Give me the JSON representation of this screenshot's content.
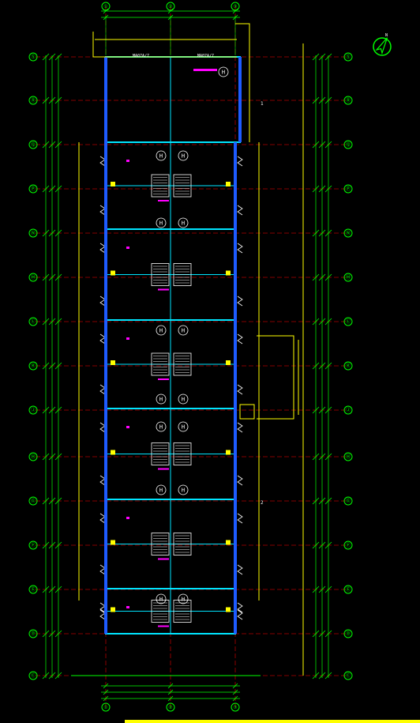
{
  "colors": {
    "background": "#000000",
    "grid_line": "#b00000",
    "dimension": "#00ff00",
    "wall": "#00e5ff",
    "wall_fill": "#1e5bff",
    "annotation": "#ff00ff",
    "stair": "#ffffff",
    "misc": "#ffff00"
  },
  "grid_axes": {
    "columns": [
      "①",
      "②",
      "③"
    ],
    "rows": [
      "Ⓢ",
      "Ⓡ",
      "Ⓠ",
      "Ⓟ",
      "Ⓝ",
      "Ⓜ",
      "Ⓛ",
      "Ⓚ",
      "Ⓙ",
      "Ⓗ",
      "Ⓖ",
      "Ⓕ",
      "Ⓔ",
      "Ⓓ",
      "Ⓒ",
      "Ⓑ"
    ]
  },
  "north_arrow": {
    "label": "N",
    "icon": "north-arrow-icon"
  },
  "room_tags": {
    "top_room": "H",
    "unit": [
      "H",
      "H",
      "H",
      "H",
      "H",
      "H",
      "H",
      "H",
      "H",
      "H",
      "H",
      "H",
      "H",
      "H"
    ]
  },
  "top_labels": [
    "MA07A/7",
    "MA07A/7"
  ],
  "section_marks": [
    "1",
    "2"
  ]
}
